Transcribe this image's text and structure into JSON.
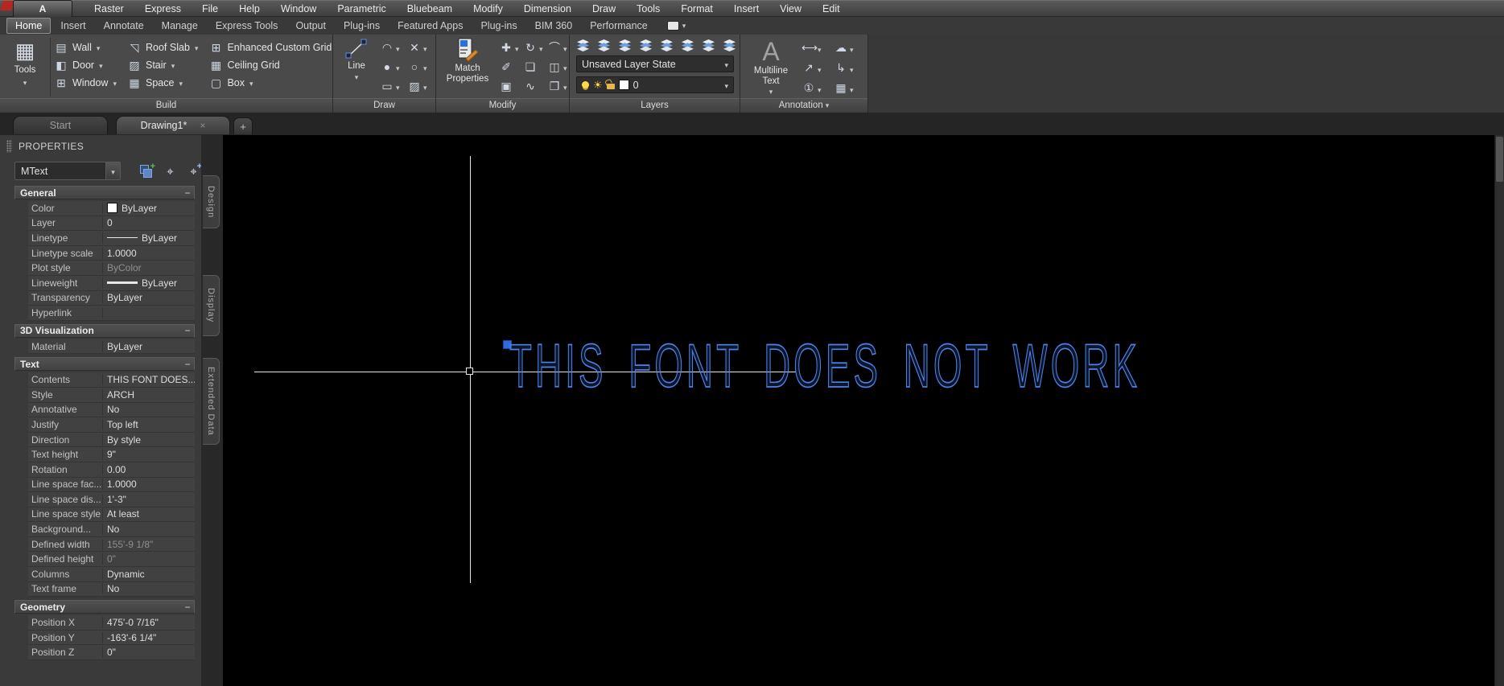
{
  "menubar": {
    "logo_letter": "A",
    "items": [
      "Raster",
      "Express",
      "File",
      "Help",
      "Window",
      "Parametric",
      "Bluebeam",
      "Modify",
      "Dimension",
      "Draw",
      "Tools",
      "Format",
      "Insert",
      "View",
      "Edit"
    ]
  },
  "ribbon_tabs": {
    "items": [
      {
        "label": "Home",
        "active": true
      },
      {
        "label": "Insert"
      },
      {
        "label": "Annotate"
      },
      {
        "label": "Manage"
      },
      {
        "label": "Express Tools"
      },
      {
        "label": "Output"
      },
      {
        "label": "Plug-ins"
      },
      {
        "label": "Featured Apps"
      },
      {
        "label": "Plug-ins"
      },
      {
        "label": "BIM 360"
      },
      {
        "label": "Performance"
      }
    ]
  },
  "ribbon": {
    "panels": {
      "build": {
        "label": "Build",
        "tools_button": {
          "label": "Tools",
          "icon_glyph": "▦"
        },
        "columns": [
          [
            {
              "name": "wall",
              "label": "Wall",
              "glyph": "▤",
              "dd": true
            },
            {
              "name": "door",
              "label": "Door",
              "glyph": "◧",
              "dd": true
            },
            {
              "name": "window",
              "label": "Window",
              "glyph": "⊞",
              "dd": true
            }
          ],
          [
            {
              "name": "roof-slab",
              "label": "Roof Slab",
              "glyph": "◹",
              "dd": true
            },
            {
              "name": "stair",
              "label": "Stair",
              "glyph": "▨",
              "dd": true
            },
            {
              "name": "space",
              "label": "Space",
              "glyph": "▦",
              "dd": true
            }
          ],
          [
            {
              "name": "enhanced-custom-grid",
              "label": "Enhanced Custom Grid",
              "glyph": "⊞",
              "dd": true
            },
            {
              "name": "ceiling-grid",
              "label": "Ceiling Grid",
              "glyph": "▦",
              "dd": false
            },
            {
              "name": "box",
              "label": "Box",
              "glyph": "▢",
              "dd": true
            }
          ]
        ]
      },
      "draw": {
        "label": "Draw",
        "line_button": {
          "label": "Line"
        },
        "grid": [
          {
            "name": "arc",
            "glyph": "◠",
            "dd": true
          },
          {
            "name": "construction-line",
            "glyph": "✕",
            "dd": true
          },
          {
            "name": "circle",
            "glyph": "●",
            "dd": true
          },
          {
            "name": "ellipse",
            "glyph": "○",
            "dd": true
          },
          {
            "name": "rectangle",
            "glyph": "▭",
            "dd": true
          },
          {
            "name": "hatch",
            "glyph": "▨",
            "dd": true
          }
        ]
      },
      "modify": {
        "label": "Modify",
        "match_button": {
          "label": "Match Properties"
        },
        "grid": [
          {
            "name": "move",
            "glyph": "✚",
            "dd": true
          },
          {
            "name": "rotate",
            "glyph": "↻",
            "dd": true
          },
          {
            "name": "fillet",
            "glyph": "⌒",
            "dd": true
          },
          {
            "name": "erase",
            "glyph": "✐",
            "dd": false
          },
          {
            "name": "copy",
            "glyph": "❏",
            "dd": false
          },
          {
            "name": "mirror",
            "glyph": "◫",
            "dd": true
          },
          {
            "name": "3d-tools",
            "glyph": "▣",
            "dd": false
          },
          {
            "name": "edit-polyline",
            "glyph": "∿",
            "dd": false
          },
          {
            "name": "draw-order",
            "glyph": "❐",
            "dd": true
          }
        ]
      },
      "layers": {
        "label": "Layers",
        "state_combo": "Unsaved Layer State",
        "current_layer": "0",
        "top_icons": [
          "layer-properties-icon",
          "layer-off-icon",
          "make-current-icon",
          "layer-freeze-icon",
          "layer-isolate-icon",
          "layer-match-icon",
          "layer-previous-icon",
          "layer-states-icon"
        ]
      },
      "annotation": {
        "label": "Annotation",
        "mtext_button": {
          "label": "Multiline Text",
          "big_letter": "A"
        },
        "grid": [
          {
            "name": "dimension",
            "glyph": "⟷",
            "dd": true
          },
          {
            "name": "revision-cloud",
            "glyph": "☁",
            "dd": true
          },
          {
            "name": "multileader",
            "glyph": "↗",
            "dd": true
          },
          {
            "name": "leader",
            "glyph": "↳",
            "dd": true
          },
          {
            "name": "bubble-callout",
            "glyph": "①",
            "dd": true
          },
          {
            "name": "table",
            "glyph": "▦",
            "dd": true
          }
        ]
      }
    }
  },
  "doc_tabs": {
    "tabs": [
      {
        "label": "Start",
        "active": false,
        "closable": false
      },
      {
        "label": "Drawing1*",
        "active": true,
        "closable": true
      }
    ],
    "new_tab_label": "+"
  },
  "palette": {
    "title": "PROPERTIES",
    "type_selector": "MText",
    "toolbar": [
      {
        "name": "quick-select"
      },
      {
        "name": "toggle-pickadd"
      },
      {
        "name": "select-objects"
      }
    ],
    "sections": [
      {
        "title": "General",
        "rows": [
          {
            "label": "Color",
            "value": "ByLayer",
            "swatch": "#ffffff"
          },
          {
            "label": "Layer",
            "value": "0"
          },
          {
            "label": "Linetype",
            "value": "ByLayer",
            "line": "thin"
          },
          {
            "label": "Linetype scale",
            "value": "1.0000"
          },
          {
            "label": "Plot style",
            "value": "ByColor",
            "dim": true
          },
          {
            "label": "Lineweight",
            "value": "ByLayer",
            "line": "thick"
          },
          {
            "label": "Transparency",
            "value": "ByLayer"
          },
          {
            "label": "Hyperlink",
            "value": ""
          }
        ]
      },
      {
        "title": "3D Visualization",
        "rows": [
          {
            "label": "Material",
            "value": "ByLayer"
          }
        ]
      },
      {
        "title": "Text",
        "rows": [
          {
            "label": "Contents",
            "value": "THIS FONT DOES..."
          },
          {
            "label": "Style",
            "value": "ARCH"
          },
          {
            "label": "Annotative",
            "value": "No"
          },
          {
            "label": "Justify",
            "value": "Top left"
          },
          {
            "label": "Direction",
            "value": "By style"
          },
          {
            "label": "Text height",
            "value": "9\""
          },
          {
            "label": "Rotation",
            "value": "0.00"
          },
          {
            "label": "Line space fac...",
            "value": "1.0000"
          },
          {
            "label": "Line space dis...",
            "value": "1'-3\""
          },
          {
            "label": "Line space style",
            "value": "At least"
          },
          {
            "label": "Background...",
            "value": "No"
          },
          {
            "label": "Defined width",
            "value": "155'-9 1/8\"",
            "dim": true
          },
          {
            "label": "Defined height",
            "value": "0\"",
            "dim": true
          },
          {
            "label": "Columns",
            "value": "Dynamic"
          },
          {
            "label": "Text frame",
            "value": "No"
          }
        ]
      },
      {
        "title": "Geometry",
        "rows": [
          {
            "label": "Position X",
            "value": "475'-0 7/16\""
          },
          {
            "label": "Position Y",
            "value": "-163'-6 1/4\""
          },
          {
            "label": "Position Z",
            "value": "0\""
          }
        ]
      }
    ],
    "side_tabs": [
      "Design",
      "Display",
      "Extended Data"
    ]
  },
  "canvas": {
    "mtext": "THIS FONT DOES NOT WORK",
    "text_color": "#4d82ea",
    "grip_color": "#2e6be0",
    "crosshair_color": "#e6e6e6"
  }
}
